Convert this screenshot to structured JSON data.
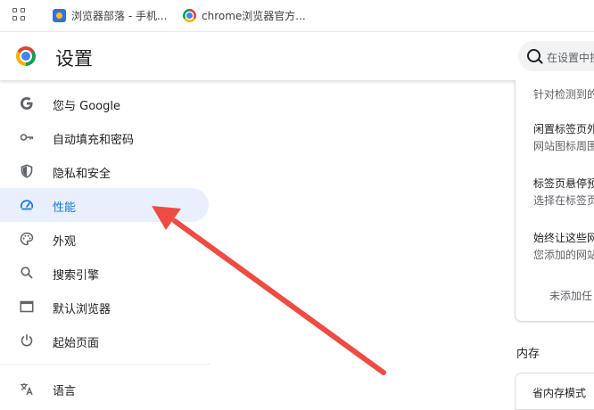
{
  "bookmarks": {
    "items": [
      {
        "label": "浏览器部落 - 手机..."
      },
      {
        "label": "chrome浏览器官方..."
      }
    ]
  },
  "header": {
    "title": "设置",
    "search_placeholder": "在设置中搜"
  },
  "sidebar": {
    "items": [
      {
        "label": "您与 Google",
        "icon": "google-icon"
      },
      {
        "label": "自动填充和密码",
        "icon": "key-icon"
      },
      {
        "label": "隐私和安全",
        "icon": "shield-icon"
      },
      {
        "label": "性能",
        "icon": "gauge-icon",
        "active": true
      },
      {
        "label": "外观",
        "icon": "palette-icon"
      },
      {
        "label": "搜索引擎",
        "icon": "search-icon"
      },
      {
        "label": "默认浏览器",
        "icon": "browser-window-icon"
      },
      {
        "label": "起始页面",
        "icon": "power-icon"
      },
      {
        "label": "语言",
        "icon": "translate-icon"
      }
    ]
  },
  "performance_panel": {
    "rows": [
      {
        "line2": "针对检测到的"
      },
      {
        "line1": "闲置标签页外",
        "line2": "网站图标周围"
      },
      {
        "line1": "标签页悬停预",
        "line2": "选择在标签页"
      },
      {
        "line1": "始终让这些网",
        "line2": "您添加的网站"
      }
    ],
    "empty_text": "未添加任",
    "memory_section_title": "内存",
    "memory_saver_label": "省内存模式"
  },
  "colors": {
    "accent": "#1a73e8",
    "active_bg": "#e8f0fe",
    "arrow": "#ee4b42"
  }
}
